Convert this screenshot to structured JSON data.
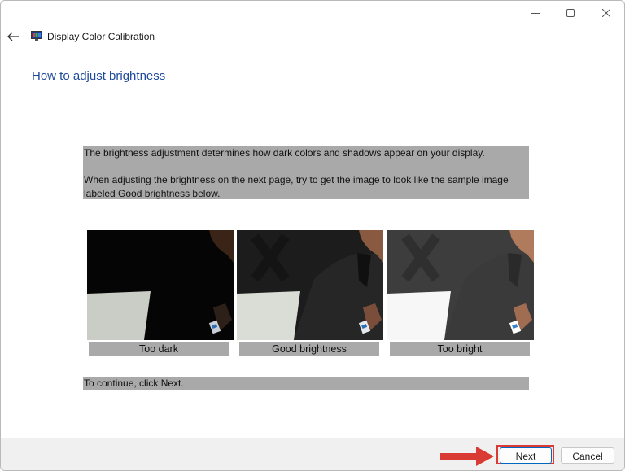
{
  "window": {
    "title": "Display Color Calibration",
    "controls": [
      "minimize-icon",
      "maximize-icon",
      "close-icon"
    ]
  },
  "header": {
    "back_icon": "back-arrow-icon",
    "app_icon": "display-calibration-icon"
  },
  "page": {
    "title": "How to adjust brightness",
    "instruction_1": "The brightness adjustment determines how dark colors and shadows appear on your display.",
    "instruction_2": "When adjusting the brightness on the next page, try to get the image to look like the sample image labeled Good brightness below.",
    "samples": [
      {
        "label": "Too dark"
      },
      {
        "label": "Good brightness"
      },
      {
        "label": "Too bright"
      }
    ],
    "continue_text": "To continue, click Next."
  },
  "footer": {
    "next_label": "Next",
    "cancel_label": "Cancel"
  },
  "colors": {
    "title_blue": "#1e4a9a",
    "text_highlight_gray": "#a9a9a9",
    "annotation_red": "#d93a34",
    "default_button_border": "#0067c0"
  }
}
